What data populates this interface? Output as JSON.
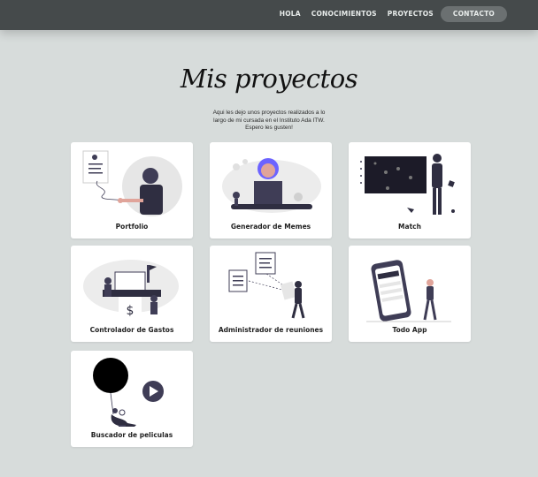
{
  "nav": {
    "items": [
      {
        "label": "HOLA"
      },
      {
        "label": "CONOCIMIENTOS"
      },
      {
        "label": "PROYECTOS"
      },
      {
        "label": "CONTACTO"
      }
    ]
  },
  "header": {
    "title": "Mis proyectos",
    "subtitle": "Aqui les dejo unos proyectos realizados a lo largo de mi cursada en el Instituto Ada ITW. Espero les gusten!"
  },
  "projects": [
    {
      "label": "Portfolio",
      "illustration": "person-with-cv-icon"
    },
    {
      "label": "Generador de Memes",
      "illustration": "person-laptop-icon"
    },
    {
      "label": "Match",
      "illustration": "person-board-icon"
    },
    {
      "label": "Controlador de Gastos",
      "illustration": "expenses-icon"
    },
    {
      "label": "Administrador de reuniones",
      "illustration": "meetings-icon"
    },
    {
      "label": "Todo App",
      "illustration": "phone-todo-icon"
    },
    {
      "label": "Buscador de peliculas",
      "illustration": "movie-balloon-icon"
    }
  ],
  "colors": {
    "topbar": "#454a4b",
    "background": "#d7dcdb",
    "card": "#ffffff",
    "cta": "#6b7071",
    "accent": "#3f3d56"
  }
}
